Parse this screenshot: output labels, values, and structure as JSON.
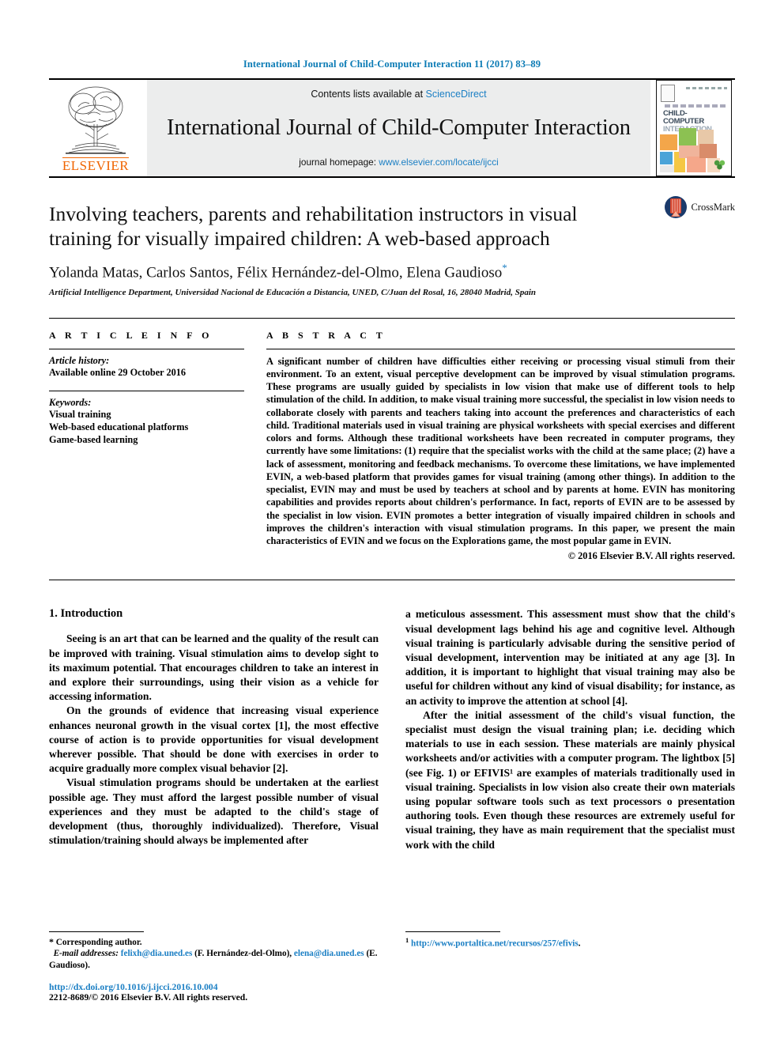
{
  "running_head": "International Journal of Child-Computer Interaction 11 (2017) 83–89",
  "masthead": {
    "publisher_name": "ELSEVIER",
    "contents_prefix": "Contents lists available at",
    "contents_link": "ScienceDirect",
    "journal_title": "International Journal of Child-Computer Interaction",
    "homepage_prefix": "journal homepage:",
    "homepage_link": "www.elsevier.com/locate/ijcci",
    "cover": {
      "title_line1": "CHILD-COMPUTER",
      "title_line2": "INTERACTION",
      "kicker": "INTERNATIONAL JOURNAL OF"
    }
  },
  "article": {
    "title": "Involving teachers, parents and rehabilitation instructors in visual training for visually impaired children: A web-based approach",
    "authors": "Yolanda Matas, Carlos Santos, Félix Hernández-del-Olmo, Elena Gaudioso",
    "author_star": "*",
    "affiliation": "Artificial Intelligence Department, Universidad Nacional de Educación a Distancia, UNED, C/Juan del Rosal, 16, 28040 Madrid, Spain",
    "crossmark_label": "CrossMark"
  },
  "info": {
    "heading": "A R T I C L E   I N F O",
    "history_label": "Article history:",
    "history_value": "Available online 29 October 2016",
    "keywords_label": "Keywords:",
    "keywords": [
      "Visual training",
      "Web-based educational platforms",
      "Game-based learning"
    ]
  },
  "abstract": {
    "heading": "A B S T R A C T",
    "text": "A significant number of children have difficulties either receiving or processing visual stimuli from their environment. To an extent, visual perceptive development can be improved by visual stimulation programs. These programs are usually guided by specialists in low vision that make use of different tools to help stimulation of the child. In addition, to make visual training more successful, the specialist in low vision needs to collaborate closely with parents and teachers taking into account the preferences and characteristics of each child. Traditional materials used in visual training are physical worksheets with special exercises and different colors and forms. Although these traditional worksheets have been recreated in computer programs, they currently have some limitations: (1) require that the specialist works with the child at the same place; (2) have a lack of assessment, monitoring and feedback mechanisms. To overcome these limitations, we have implemented EVIN, a web-based platform that provides games for visual training (among other things). In addition to the specialist, EVIN may and must be used by teachers at school and by parents at home. EVIN has monitoring capabilities and provides reports about children's performance. In fact, reports of EVIN are to be assessed by the specialist in low vision. EVIN promotes a better integration of visually impaired children in schools and improves the children's interaction with visual stimulation programs. In this paper, we present the main characteristics of EVIN and we focus on the Explorations game, the most popular game in EVIN.",
    "copyright": "© 2016 Elsevier B.V. All rights reserved."
  },
  "body": {
    "section_heading": "1. Introduction",
    "left_paragraphs": [
      "Seeing is an art that can be learned and the quality of the result can be improved with training. Visual stimulation aims to develop sight to its maximum potential. That encourages children to take an interest in and explore their surroundings, using their vision as a vehicle for accessing information.",
      "On the grounds of evidence that increasing visual experience enhances neuronal growth in the visual cortex [1], the most effective course of action is to provide opportunities for visual development wherever possible. That should be done with exercises in order to acquire gradually more complex visual behavior [2].",
      "Visual stimulation programs should be undertaken at the earliest possible age. They must afford the largest possible number of visual experiences and they must be adapted to the child's stage of development (thus, thoroughly individualized). Therefore, Visual stimulation/training should always be implemented after"
    ],
    "right_paragraphs": [
      "a meticulous assessment. This assessment must show that the child's visual development lags behind his age and cognitive level. Although visual training is particularly advisable during the sensitive period of visual development, intervention may be initiated at any age [3]. In addition, it is important to highlight that visual training may also be useful for children without any kind of visual disability; for instance, as an activity to improve the attention at school [4].",
      "After the initial assessment of the child's visual function, the specialist must design the visual training plan; i.e. deciding which materials to use in each session. These materials are mainly physical worksheets and/or activities with a computer program. The lightbox [5] (see Fig. 1) or EFIVIS¹ are examples of materials traditionally used in visual training. Specialists in low vision also create their own materials using popular software tools such as text processors o presentation authoring tools. Even though these resources are extremely useful for visual training, they have as main requirement that the specialist must work with the child"
    ]
  },
  "footnotes": {
    "corresponding_marker": "*",
    "corresponding_text": "Corresponding author.",
    "email_label": "E-mail addresses:",
    "email_1": "felixh@dia.uned.es",
    "email_1_owner": "(F. Hernández-del-Olmo),",
    "email_2": "elena@dia.uned.es",
    "email_2_owner": "(E. Gaudioso).",
    "doi_link": "http://dx.doi.org/10.1016/j.ijcci.2016.10.004",
    "issn_line": "2212-8689/© 2016 Elsevier B.V. All rights reserved.",
    "fn1_marker": "1",
    "fn1_link": "http://www.portaltica.net/recursos/257/efivis"
  },
  "colors": {
    "link_blue": "#1b7fc4",
    "running_head_blue": "#0b7bb5",
    "elsevier_orange": "#f06400",
    "masthead_gray": "#eceded"
  }
}
